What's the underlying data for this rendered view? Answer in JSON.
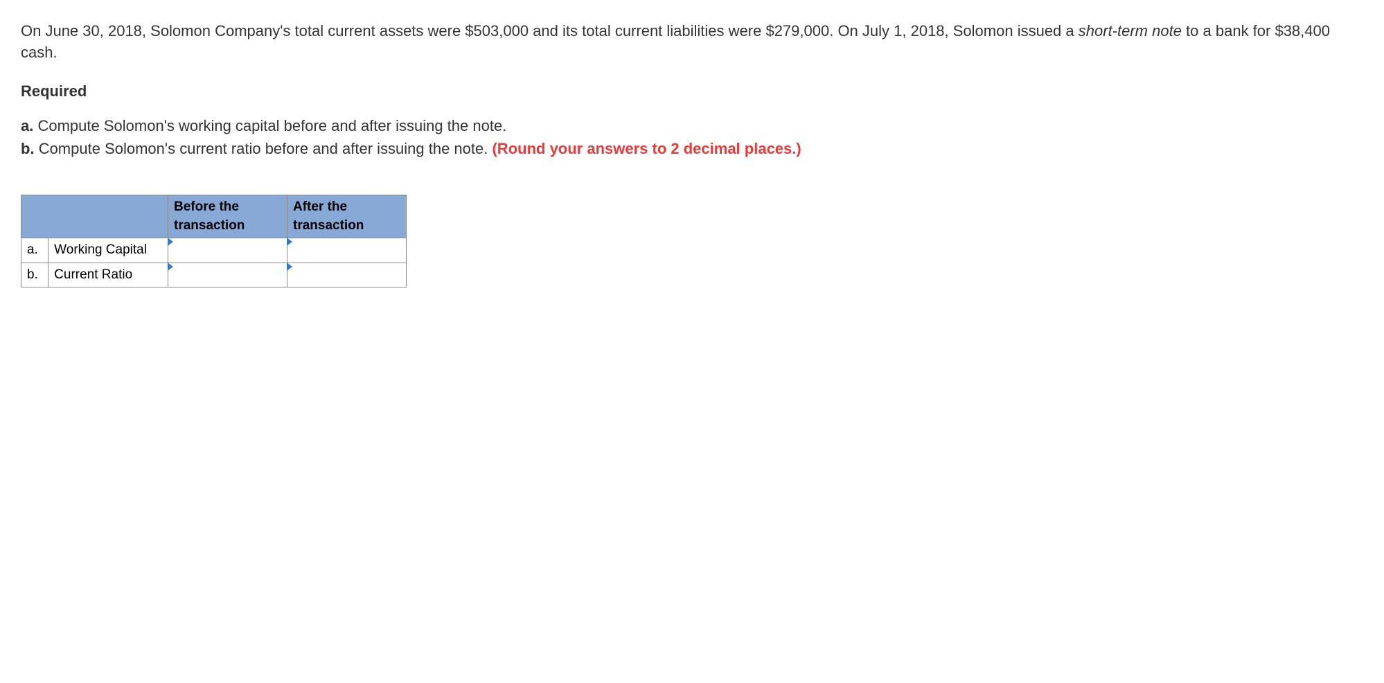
{
  "problem": {
    "intro_part1": "On June 30, 2018, Solomon Company's total current assets were $503,000 and its total current liabilities were $279,000. On July 1, 2018, Solomon issued a ",
    "intro_italic": "short-term note",
    "intro_part2": " to a bank for $38,400 cash."
  },
  "required_label": "Required",
  "requirements": {
    "a": {
      "letter": "a.",
      "text": "Compute Solomon's working capital before and after issuing the note."
    },
    "b": {
      "letter": "b.",
      "text": "Compute Solomon's current ratio before and after issuing the note. ",
      "hint": "(Round your answers to 2 decimal places.)"
    }
  },
  "table": {
    "headers": {
      "before": "Before the transaction",
      "after": "After the transaction"
    },
    "rows": {
      "a": {
        "letter": "a.",
        "label": "Working Capital",
        "before_value": "",
        "after_value": ""
      },
      "b": {
        "letter": "b.",
        "label": "Current Ratio",
        "before_value": "",
        "after_value": ""
      }
    }
  }
}
